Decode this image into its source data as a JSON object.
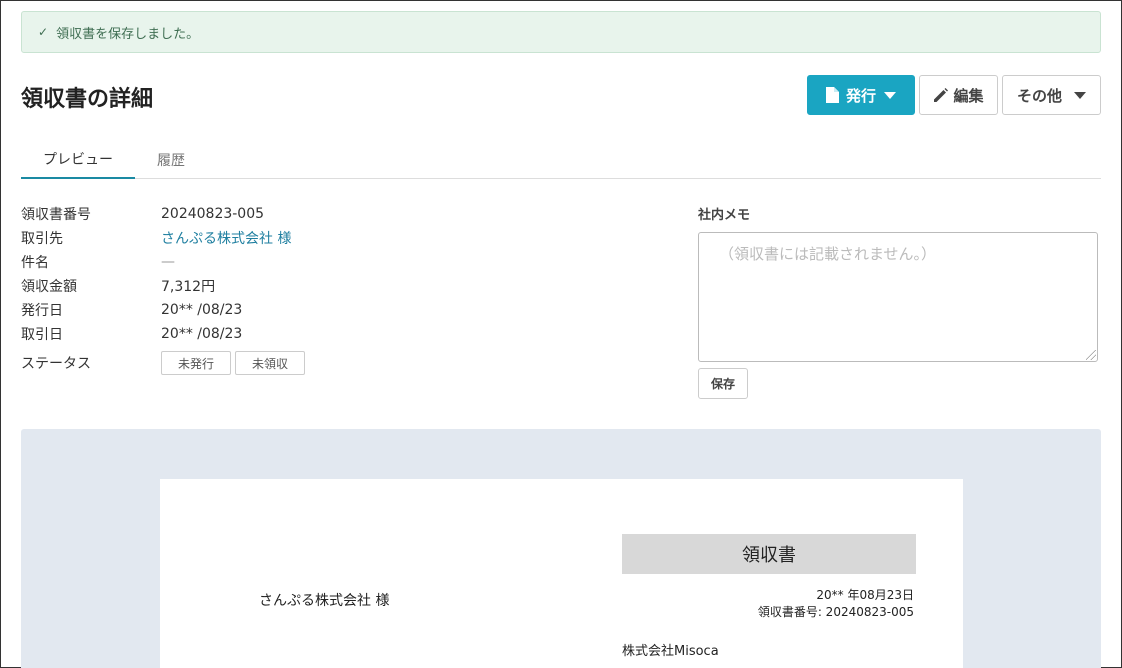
{
  "alert": {
    "message": "領収書を保存しました。"
  },
  "page": {
    "title": "領収書の詳細"
  },
  "toolbar": {
    "issue_label": "発行",
    "edit_label": "編集",
    "other_label": "その他"
  },
  "tabs": [
    {
      "label": "プレビュー",
      "active": true
    },
    {
      "label": "履歴",
      "active": false
    }
  ],
  "details": {
    "receipt_number": {
      "label": "領収書番号",
      "value": "20240823-005"
    },
    "client": {
      "label": "取引先",
      "value": "さんぷる株式会社 様"
    },
    "subject": {
      "label": "件名",
      "value": "—"
    },
    "amount": {
      "label": "領収金額",
      "value": "7,312円"
    },
    "issue_date": {
      "label": "発行日",
      "value": "20** /08/23"
    },
    "transaction_date": {
      "label": "取引日",
      "value": "20** /08/23"
    },
    "status": {
      "label": "ステータス",
      "badges": [
        "未発行",
        "未領収"
      ]
    }
  },
  "memo": {
    "label": "社内メモ",
    "placeholder": "（領収書には記載されません。）",
    "value": "",
    "save_label": "保存"
  },
  "document": {
    "title": "領収書",
    "recipient": "さんぷる株式会社 様",
    "date": "20** 年08月23日",
    "number_line": "領収書番号: 20240823-005",
    "issuer": "株式会社Misoca"
  },
  "colors": {
    "primary": "#1aa5c2",
    "link": "#1f7fa0",
    "success_bg": "#e8f4ec",
    "preview_bg": "#e2e8f0"
  }
}
